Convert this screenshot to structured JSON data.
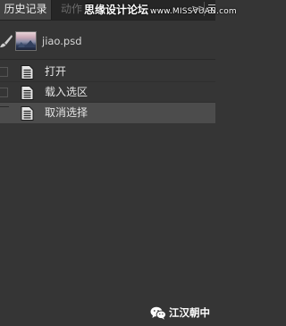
{
  "panel": {
    "tabs": [
      {
        "label": "历史记录",
        "active": true
      },
      {
        "label": "动作",
        "active": false
      }
    ],
    "watermark": {
      "text": "思缘设计论坛",
      "site": "www.MISSVUAN.com"
    },
    "collapse_glyph": ">>"
  },
  "snapshot": {
    "label": "jiao.psd",
    "icon": "brush-icon"
  },
  "history": {
    "items": [
      {
        "label": "打开",
        "selected": false,
        "icon": "document-icon"
      },
      {
        "label": "载入选区",
        "selected": false,
        "icon": "document-icon"
      },
      {
        "label": "取消选择",
        "selected": true,
        "icon": "document-icon"
      }
    ]
  },
  "badge": {
    "label": "江汉朝中",
    "icon": "wechat-icon"
  },
  "colors": {
    "panel_bg": "#353535",
    "tab_bar_bg": "#262626",
    "active_tab_bg": "#424242",
    "selected_row_bg": "#4c4c4c",
    "text": "#e4e4e4"
  }
}
